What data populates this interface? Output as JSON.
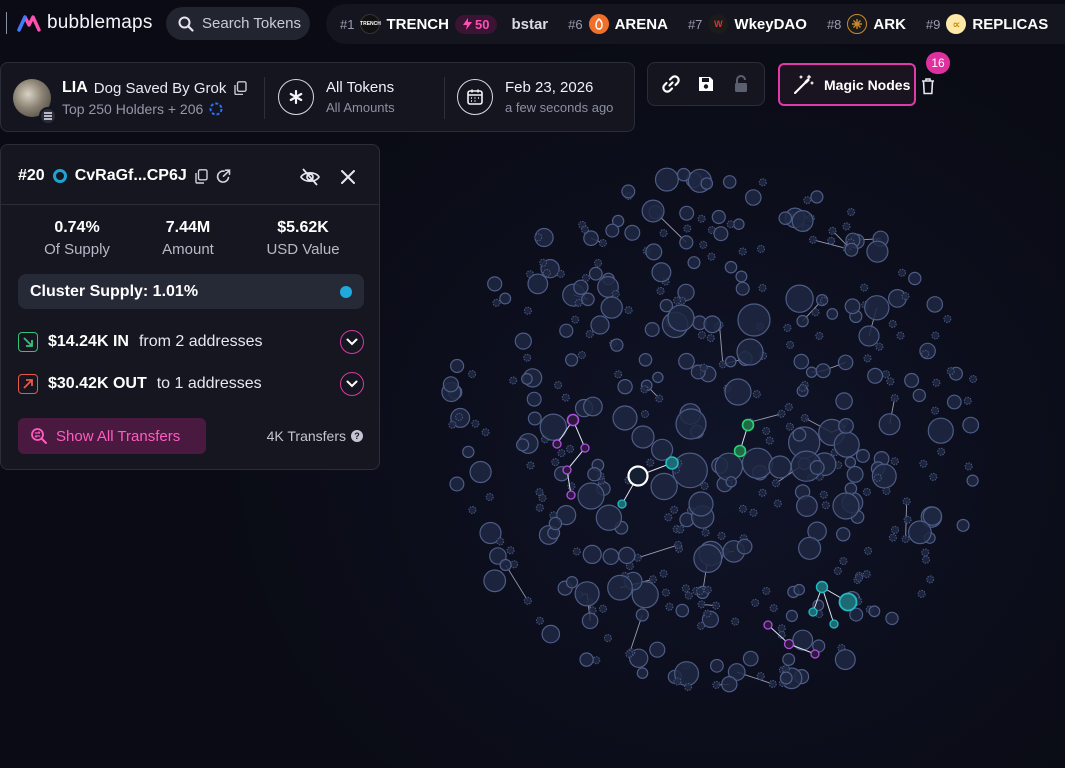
{
  "brand": {
    "name": "bubblemaps"
  },
  "search": {
    "label": "Search Tokens"
  },
  "trending": [
    {
      "rank": "#1",
      "name": "TRENCH",
      "boost": "50",
      "icon_text": "TRENCH",
      "icon_bg": "#111111",
      "icon_fg": "#ffffff"
    },
    {
      "rank": "",
      "name": "bstar",
      "partial": true
    },
    {
      "rank": "#6",
      "name": "ARENA",
      "icon_text": "",
      "icon_bg": "#f0702a",
      "icon_fg": "#ffffff"
    },
    {
      "rank": "#7",
      "name": "WkeyDAO",
      "icon_text": "W",
      "icon_bg": "#1b1b1b",
      "icon_fg": "#d33"
    },
    {
      "rank": "#8",
      "name": "ARK",
      "icon_text": "",
      "icon_bg": "#c9892d",
      "icon_fg": "#1b1b1b"
    },
    {
      "rank": "#9",
      "name": "REPLICAS",
      "icon_text": "",
      "icon_bg": "#ffe9a8",
      "icon_fg": "#c48a00"
    }
  ],
  "token": {
    "symbol": "LIA",
    "name": "Dog Saved By Grok",
    "subtitle": "Top 250 Holders + 206"
  },
  "filter": {
    "main": "All Tokens",
    "sub": "All Amounts"
  },
  "date": {
    "main": "Feb 23, 2026",
    "sub": "a few seconds ago"
  },
  "magic": {
    "label": "Magic Nodes",
    "badge": "16"
  },
  "wallet": {
    "rank": "#20",
    "address": "CvRaGf...CP6J",
    "stats": [
      {
        "value": "0.74%",
        "label": "Of Supply"
      },
      {
        "value": "7.44M",
        "label": "Amount"
      },
      {
        "value": "$5.62K",
        "label": "USD Value"
      }
    ],
    "cluster": "Cluster Supply: 1.01%",
    "in": {
      "amount": "$14.24K IN",
      "desc": "from 2 addresses"
    },
    "out": {
      "amount": "$30.42K OUT",
      "desc": "to 1 addresses"
    },
    "show_all": "Show All Transfers",
    "transfers": "4K Transfers"
  },
  "colors": {
    "accent": "#e03aa8",
    "cyan": "#1fa9dd",
    "in_green": "#34c27a",
    "out_red": "#e8584a"
  }
}
